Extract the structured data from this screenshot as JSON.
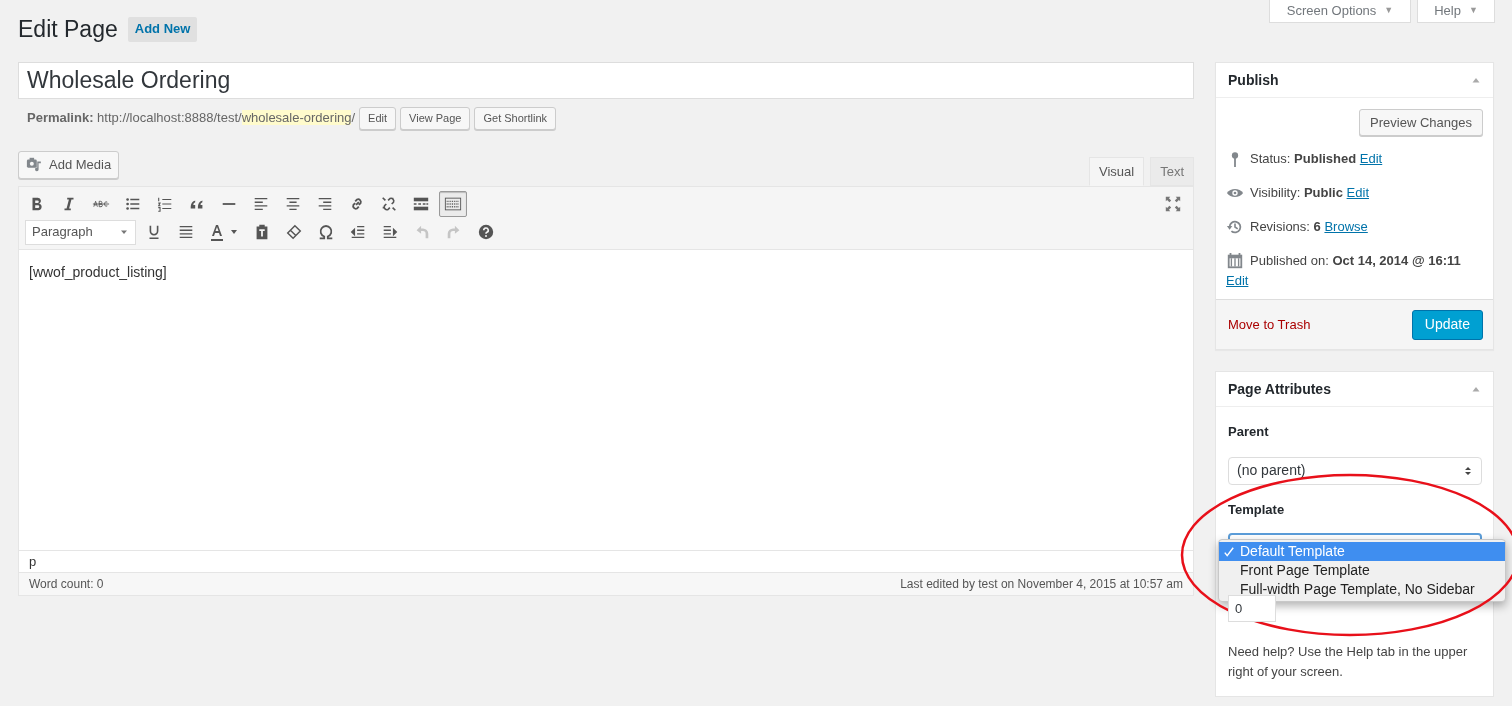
{
  "header_tabs": [
    {
      "label": "Screen Options",
      "caret": "▼"
    },
    {
      "label": "Help",
      "caret": "▼"
    }
  ],
  "heading": "Edit Page",
  "add_new": "Add New",
  "title_field": {
    "value": "Wholesale Ordering"
  },
  "permalink": {
    "label": "Permalink:",
    "base": "http://localhost:8888/test/",
    "slug": "wholesale-ordering",
    "trail": "/",
    "buttons": [
      "Edit",
      "View Page",
      "Get Shortlink"
    ]
  },
  "editor": {
    "add_media": "Add Media",
    "tabs": [
      {
        "label": "Visual",
        "selected": true
      },
      {
        "label": "Text",
        "selected": false
      }
    ],
    "format_select": "Paragraph",
    "toolbar_toggle_selected": true,
    "undo_disabled": true,
    "redo_disabled": true,
    "content": "[wwof_product_listing]",
    "path": "p",
    "word_count": "Word count: 0",
    "last_edited": "Last edited by test on November 4, 2015 at 10:57 am"
  },
  "publish": {
    "title": "Publish",
    "preview": "Preview Changes",
    "rows": [
      {
        "kind": "status",
        "label": "Status:",
        "value": "Published",
        "link": "Edit"
      },
      {
        "kind": "visibility",
        "label": "Visibility:",
        "value": "Public",
        "link": "Edit"
      },
      {
        "kind": "revisions",
        "label": "Revisions:",
        "value": "6",
        "link": "Browse"
      },
      {
        "kind": "date",
        "label": "Published on:",
        "value": "Oct 14, 2014 @ 16:11",
        "link": "Edit"
      }
    ],
    "trash": "Move to Trash",
    "update": "Update"
  },
  "page_attributes": {
    "title": "Page Attributes",
    "parent_label": "Parent",
    "parent_value": "(no parent)",
    "template_label": "Template",
    "template_options": [
      {
        "label": "Default Template",
        "selected": true
      },
      {
        "label": "Front Page Template",
        "selected": false
      },
      {
        "label": "Full-width Page Template, No Sidebar",
        "selected": false
      }
    ],
    "order_value": "0",
    "help": "Need help? Use the Help tab in the upper right of your screen."
  }
}
